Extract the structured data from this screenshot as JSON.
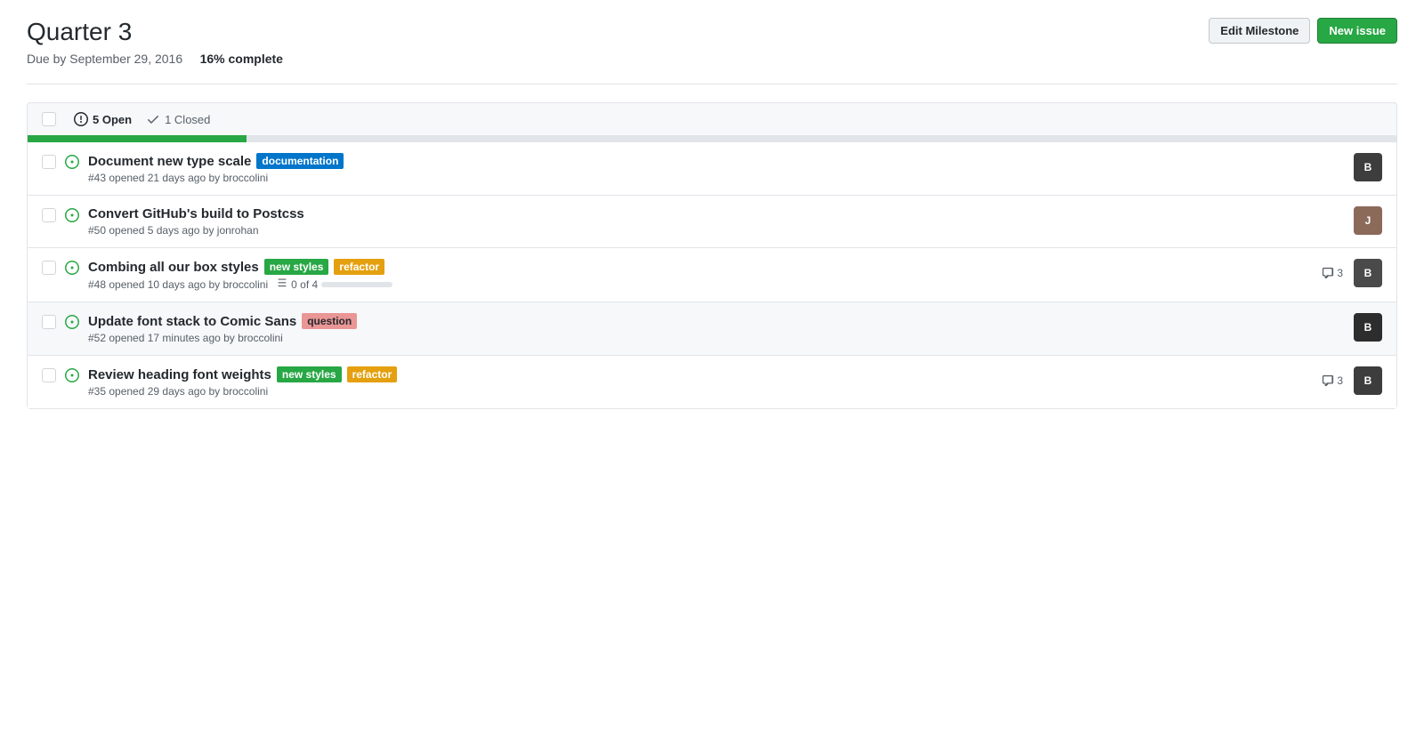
{
  "header": {
    "title": "Quarter 3",
    "due_date": "Due by September 29, 2016",
    "progress_text": "16% complete",
    "progress_percent": 16,
    "edit_button": "Edit Milestone",
    "new_issue_button": "New issue"
  },
  "issues_bar": {
    "open_count": "5 Open",
    "closed_count": "1 Closed"
  },
  "issues": [
    {
      "id": 1,
      "number": "#43",
      "title": "Document new type scale",
      "meta": "#43 opened 21 days ago by broccolini",
      "labels": [
        {
          "text": "documentation",
          "class": "label-documentation"
        }
      ],
      "highlighted": false,
      "has_comments": false,
      "has_checklist": false,
      "avatar_letter": "B",
      "avatar_class": "avatar-1"
    },
    {
      "id": 2,
      "number": "#50",
      "title": "Convert GitHub's build to Postcss",
      "meta": "#50 opened 5 days ago by jonrohan",
      "labels": [],
      "highlighted": false,
      "has_comments": false,
      "has_checklist": false,
      "avatar_letter": "J",
      "avatar_class": "avatar-2"
    },
    {
      "id": 3,
      "number": "#48",
      "title": "Combing all our box styles",
      "meta": "#48 opened 10 days ago by broccolini",
      "labels": [
        {
          "text": "new styles",
          "class": "label-new-styles"
        },
        {
          "text": "refactor",
          "class": "label-refactor"
        }
      ],
      "highlighted": false,
      "has_comments": true,
      "comment_count": "3",
      "has_checklist": true,
      "checklist_text": "0 of 4",
      "checklist_percent": 0,
      "avatar_letter": "B",
      "avatar_class": "avatar-3"
    },
    {
      "id": 4,
      "number": "#52",
      "title": "Update font stack to Comic Sans",
      "meta": "#52 opened 17 minutes ago by broccolini",
      "labels": [
        {
          "text": "question",
          "class": "label-question"
        }
      ],
      "highlighted": true,
      "has_comments": false,
      "has_checklist": false,
      "avatar_letter": "B",
      "avatar_class": "avatar-4"
    },
    {
      "id": 5,
      "number": "#35",
      "title": "Review heading font weights",
      "meta": "#35 opened 29 days ago by broccolini",
      "labels": [
        {
          "text": "new styles",
          "class": "label-new-styles"
        },
        {
          "text": "refactor",
          "class": "label-refactor"
        }
      ],
      "highlighted": false,
      "has_comments": true,
      "comment_count": "3",
      "has_checklist": false,
      "avatar_letter": "B",
      "avatar_class": "avatar-1"
    }
  ],
  "colors": {
    "green": "#28a745",
    "progress_bg": "#e1e4e8"
  }
}
